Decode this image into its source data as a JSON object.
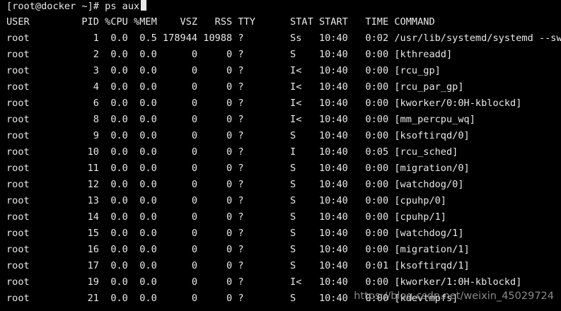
{
  "terminal": {
    "prompt": "[root@docker ~]# ps aux",
    "header": "USER         PID %CPU %MEM    VSZ   RSS TTY      STAT START   TIME COMMAND",
    "rows": [
      "root           1  0.0  0.5 178944 10988 ?        Ss   10:40   0:02 /usr/lib/systemd/systemd --sw",
      "root           2  0.0  0.0      0     0 ?        S    10:40   0:00 [kthreadd]",
      "root           3  0.0  0.0      0     0 ?        I<   10:40   0:00 [rcu_gp]",
      "root           4  0.0  0.0      0     0 ?        I<   10:40   0:00 [rcu_par_gp]",
      "root           6  0.0  0.0      0     0 ?        I<   10:40   0:00 [kworker/0:0H-kblockd]",
      "root           8  0.0  0.0      0     0 ?        I<   10:40   0:00 [mm_percpu_wq]",
      "root           9  0.0  0.0      0     0 ?        S    10:40   0:00 [ksoftirqd/0]",
      "root          10  0.0  0.0      0     0 ?        I    10:40   0:05 [rcu_sched]",
      "root          11  0.0  0.0      0     0 ?        S    10:40   0:00 [migration/0]",
      "root          12  0.0  0.0      0     0 ?        S    10:40   0:00 [watchdog/0]",
      "root          13  0.0  0.0      0     0 ?        S    10:40   0:00 [cpuhp/0]",
      "root          14  0.0  0.0      0     0 ?        S    10:40   0:00 [cpuhp/1]",
      "root          15  0.0  0.0      0     0 ?        S    10:40   0:00 [watchdog/1]",
      "root          16  0.0  0.0      0     0 ?        S    10:40   0:00 [migration/1]",
      "root          17  0.0  0.0      0     0 ?        S    10:40   0:01 [ksoftirqd/1]",
      "root          19  0.0  0.0      0     0 ?        I<   10:40   0:00 [kworker/1:0H-kblockd]",
      "root          21  0.0  0.0      0     0 ?        S    10:40   0:00 [kdevtmpfs]"
    ]
  },
  "watermark": "https://blog.csdn.net/weixin_45029724",
  "colors": {
    "background": "#000000",
    "text": "#e8e8e8"
  }
}
